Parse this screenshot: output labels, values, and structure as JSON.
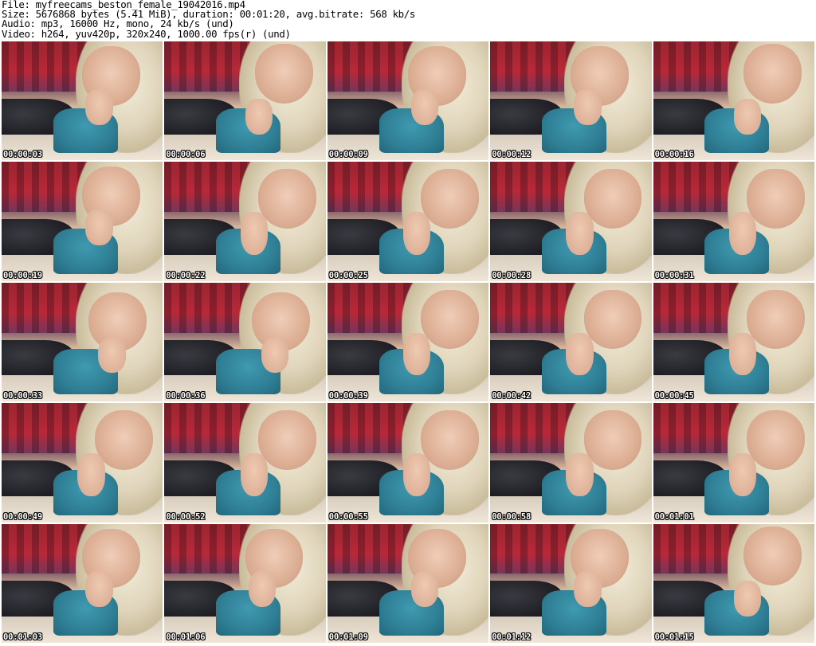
{
  "header": {
    "file_line": "File: myfreecams_beston_female_19042016.mp4",
    "size_line": "Size: 5676868 bytes (5.41 MiB), duration: 00:01:20, avg.bitrate: 568 kb/s",
    "audio_line": "Audio: mp3, 16000 Hz, mono, 24 kb/s (und)",
    "video_line": "Video: h264, yuv420p, 320x240, 1000.00 fps(r) (und)"
  },
  "thumbnails": [
    {
      "timestamp": "00:00:03",
      "variant": "a"
    },
    {
      "timestamp": "00:00:06",
      "variant": "b"
    },
    {
      "timestamp": "00:00:09",
      "variant": "a"
    },
    {
      "timestamp": "00:00:12",
      "variant": "a"
    },
    {
      "timestamp": "00:00:16",
      "variant": "b"
    },
    {
      "timestamp": "00:00:19",
      "variant": "a"
    },
    {
      "timestamp": "00:00:22",
      "variant": "c"
    },
    {
      "timestamp": "00:00:25",
      "variant": "c"
    },
    {
      "timestamp": "00:00:28",
      "variant": "c"
    },
    {
      "timestamp": "00:00:31",
      "variant": "c"
    },
    {
      "timestamp": "00:00:33",
      "variant": "d"
    },
    {
      "timestamp": "00:00:36",
      "variant": "d"
    },
    {
      "timestamp": "00:00:39",
      "variant": "c"
    },
    {
      "timestamp": "00:00:42",
      "variant": "c"
    },
    {
      "timestamp": "00:00:45",
      "variant": "c"
    },
    {
      "timestamp": "00:00:49",
      "variant": "c"
    },
    {
      "timestamp": "00:00:52",
      "variant": "c"
    },
    {
      "timestamp": "00:00:55",
      "variant": "c"
    },
    {
      "timestamp": "00:00:58",
      "variant": "c"
    },
    {
      "timestamp": "00:01:01",
      "variant": "c"
    },
    {
      "timestamp": "00:01:03",
      "variant": "a"
    },
    {
      "timestamp": "00:01:06",
      "variant": "a"
    },
    {
      "timestamp": "00:01:09",
      "variant": "a"
    },
    {
      "timestamp": "00:01:12",
      "variant": "a"
    },
    {
      "timestamp": "00:01:15",
      "variant": "b"
    }
  ]
}
